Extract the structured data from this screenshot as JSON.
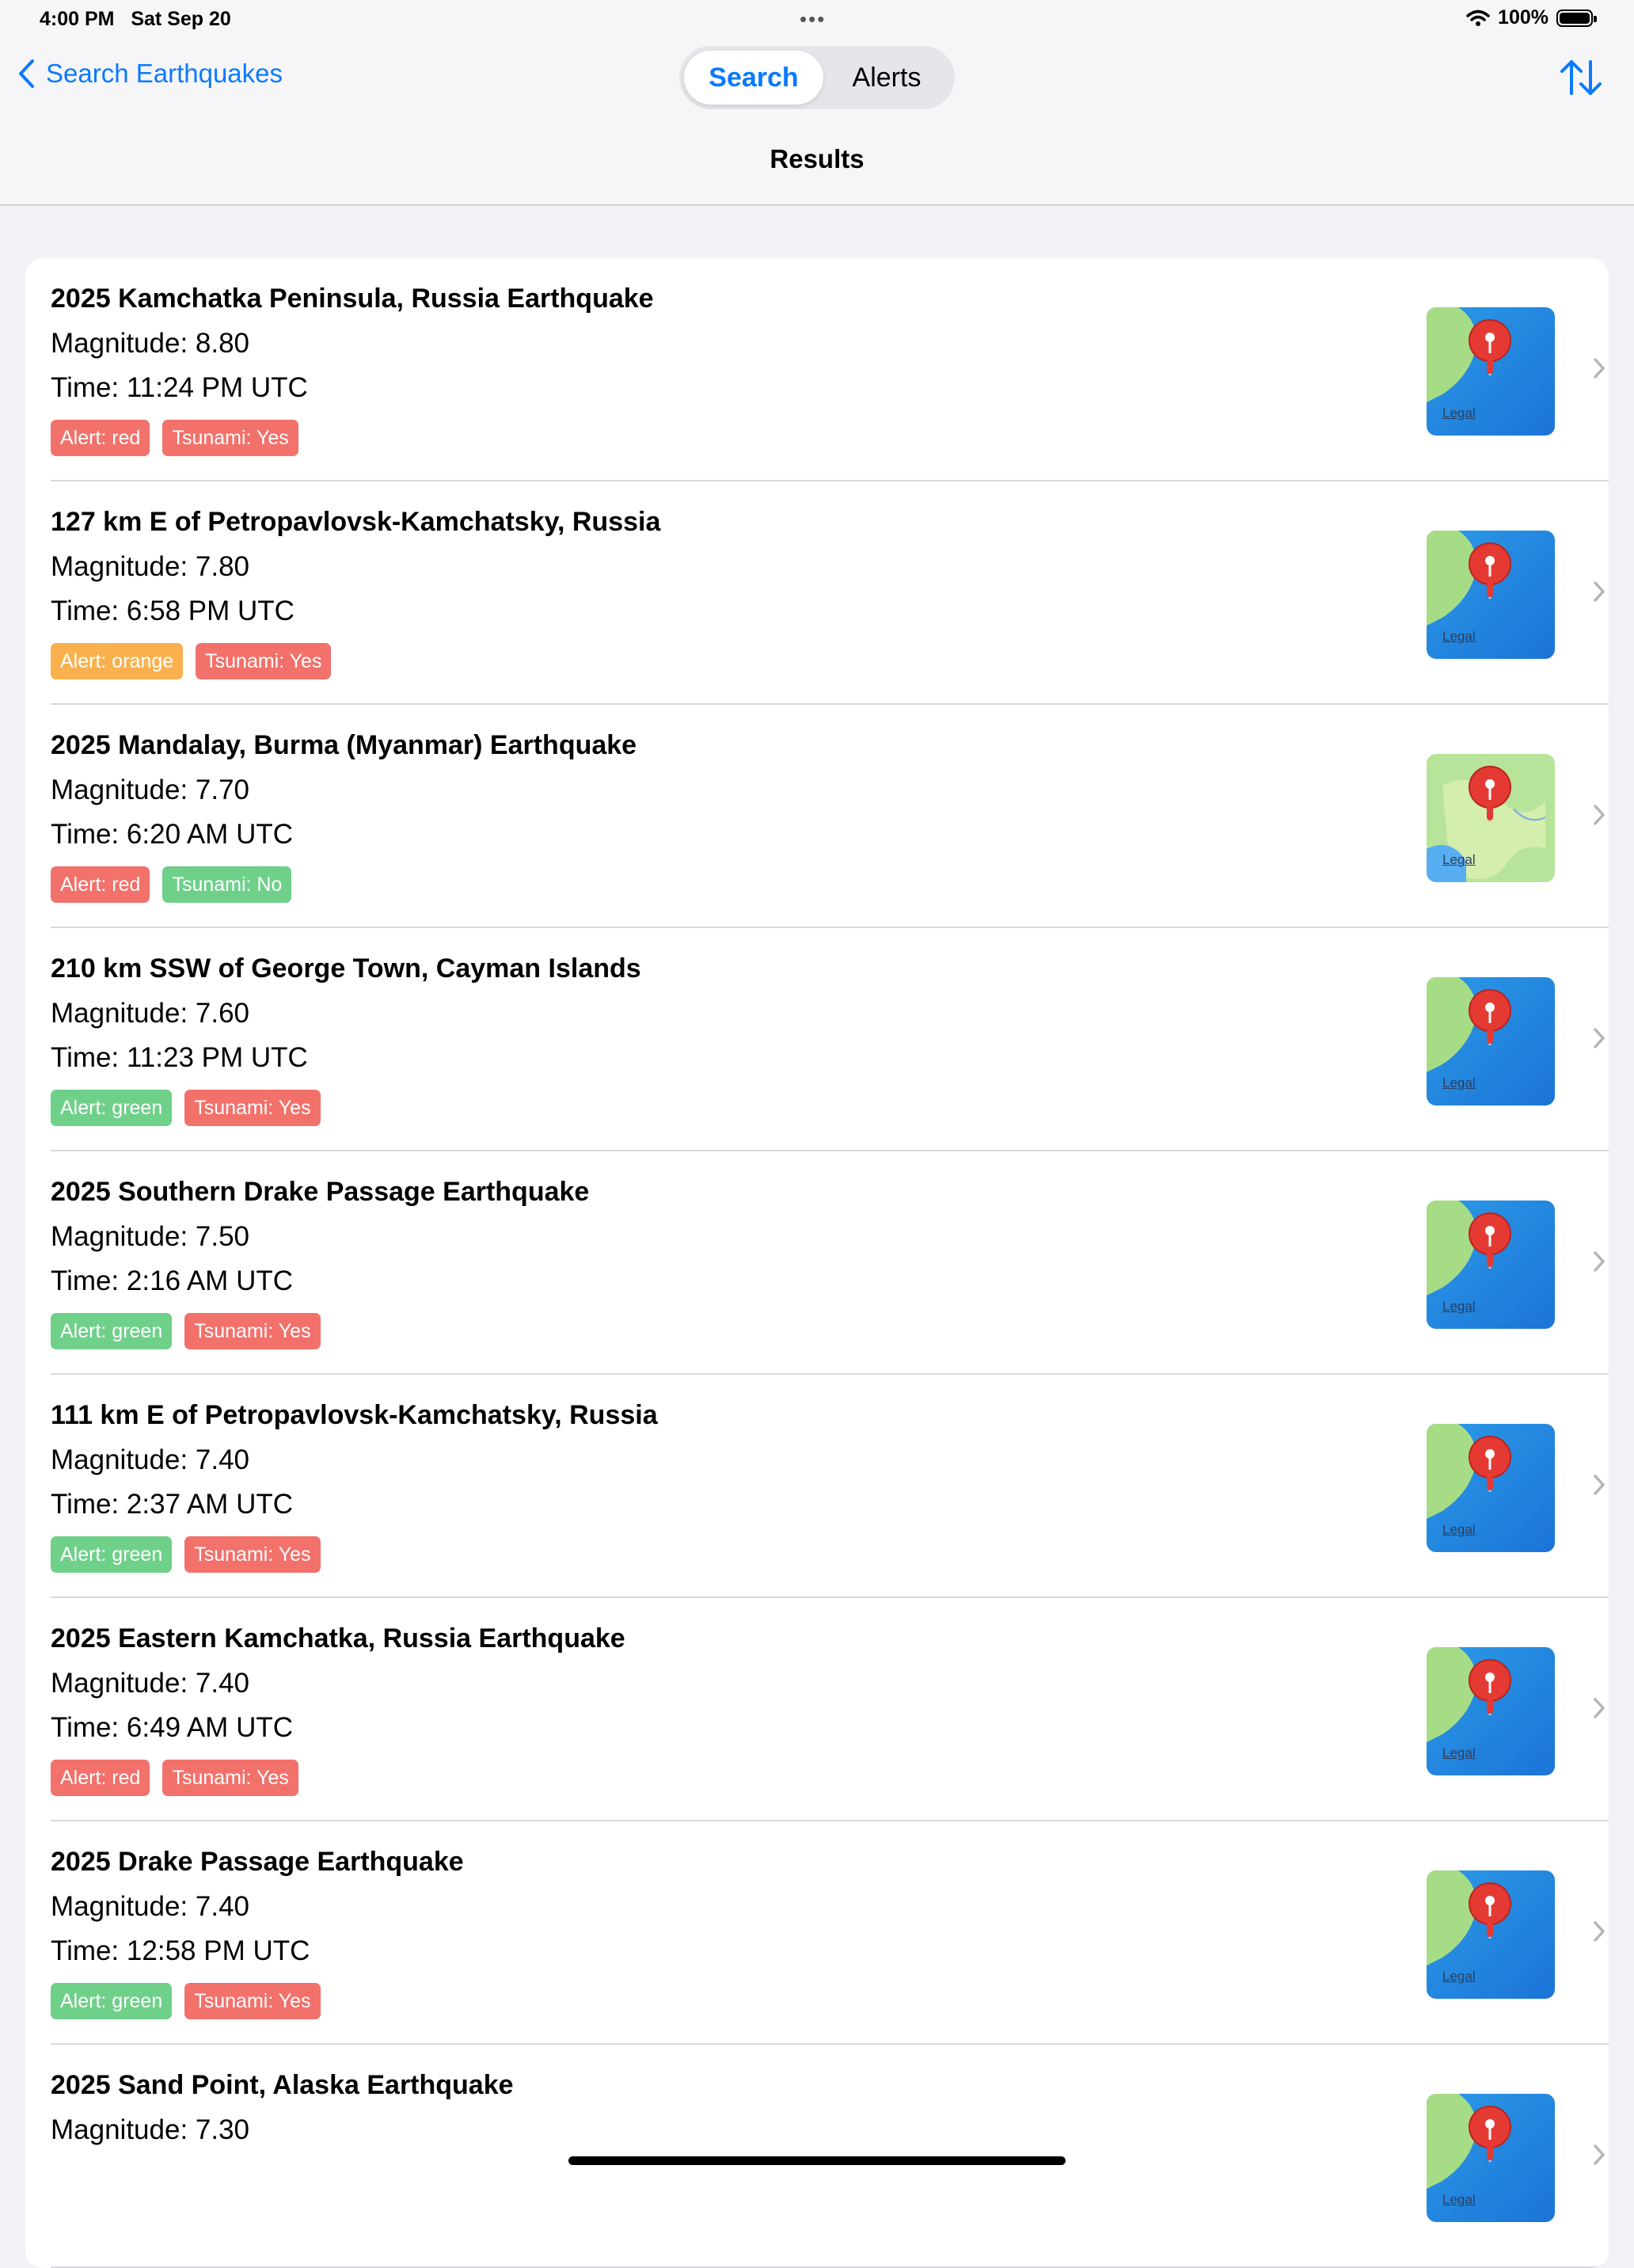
{
  "status_bar": {
    "time": "4:00 PM",
    "date": "Sat Sep 20",
    "battery": "100%"
  },
  "nav": {
    "back_label": "Search Earthquakes",
    "segments": [
      "Search",
      "Alerts"
    ],
    "selected_segment": "Search",
    "title": "Results",
    "sort_icon": "sort-arrows-icon"
  },
  "colors": {
    "accent": "#0a7aff",
    "alert_red": "#f2716b",
    "alert_orange": "#f9b04d",
    "alert_green": "#6fd08a"
  },
  "results": [
    {
      "title": "2025 Kamchatka Peninsula, Russia Earthquake",
      "magnitude": "Magnitude: 8.80",
      "time": "Time: 11:24 PM UTC",
      "alert": "Alert: red",
      "alert_color": "red",
      "tsunami": "Tsunami: Yes",
      "tsunami_color": "red",
      "map": "ocean",
      "legal": "Legal"
    },
    {
      "title": "127 km E of Petropavlovsk-Kamchatsky, Russia",
      "magnitude": "Magnitude: 7.80",
      "time": "Time: 6:58 PM UTC",
      "alert": "Alert: orange",
      "alert_color": "orange",
      "tsunami": "Tsunami: Yes",
      "tsunami_color": "red",
      "map": "ocean",
      "legal": "Legal"
    },
    {
      "title": "2025 Mandalay, Burma (Myanmar) Earthquake",
      "magnitude": "Magnitude: 7.70",
      "time": "Time: 6:20 AM UTC",
      "alert": "Alert: red",
      "alert_color": "red",
      "tsunami": "Tsunami: No",
      "tsunami_color": "green",
      "map": "land",
      "legal": "Legal"
    },
    {
      "title": "210 km SSW of George Town, Cayman Islands",
      "magnitude": "Magnitude: 7.60",
      "time": "Time: 11:23 PM UTC",
      "alert": "Alert: green",
      "alert_color": "green",
      "tsunami": "Tsunami: Yes",
      "tsunami_color": "red",
      "map": "ocean",
      "legal": "Legal"
    },
    {
      "title": "2025 Southern Drake Passage Earthquake",
      "magnitude": "Magnitude: 7.50",
      "time": "Time: 2:16 AM UTC",
      "alert": "Alert: green",
      "alert_color": "green",
      "tsunami": "Tsunami: Yes",
      "tsunami_color": "red",
      "map": "ocean",
      "legal": "Legal"
    },
    {
      "title": "111 km E of Petropavlovsk-Kamchatsky, Russia",
      "magnitude": "Magnitude: 7.40",
      "time": "Time: 2:37 AM UTC",
      "alert": "Alert: green",
      "alert_color": "green",
      "tsunami": "Tsunami: Yes",
      "tsunami_color": "red",
      "map": "ocean",
      "legal": "Legal"
    },
    {
      "title": "2025 Eastern Kamchatka, Russia Earthquake",
      "magnitude": "Magnitude: 7.40",
      "time": "Time: 6:49 AM UTC",
      "alert": "Alert: red",
      "alert_color": "red",
      "tsunami": "Tsunami: Yes",
      "tsunami_color": "red",
      "map": "ocean",
      "legal": "Legal"
    },
    {
      "title": "2025 Drake Passage Earthquake",
      "magnitude": "Magnitude: 7.40",
      "time": "Time: 12:58 PM UTC",
      "alert": "Alert: green",
      "alert_color": "green",
      "tsunami": "Tsunami: Yes",
      "tsunami_color": "red",
      "map": "ocean",
      "legal": "Legal"
    },
    {
      "title": "2025 Sand Point, Alaska Earthquake",
      "magnitude": "Magnitude: 7.30",
      "time": "",
      "alert": "",
      "alert_color": "",
      "tsunami": "",
      "tsunami_color": "",
      "map": "ocean",
      "legal": "Legal"
    }
  ]
}
